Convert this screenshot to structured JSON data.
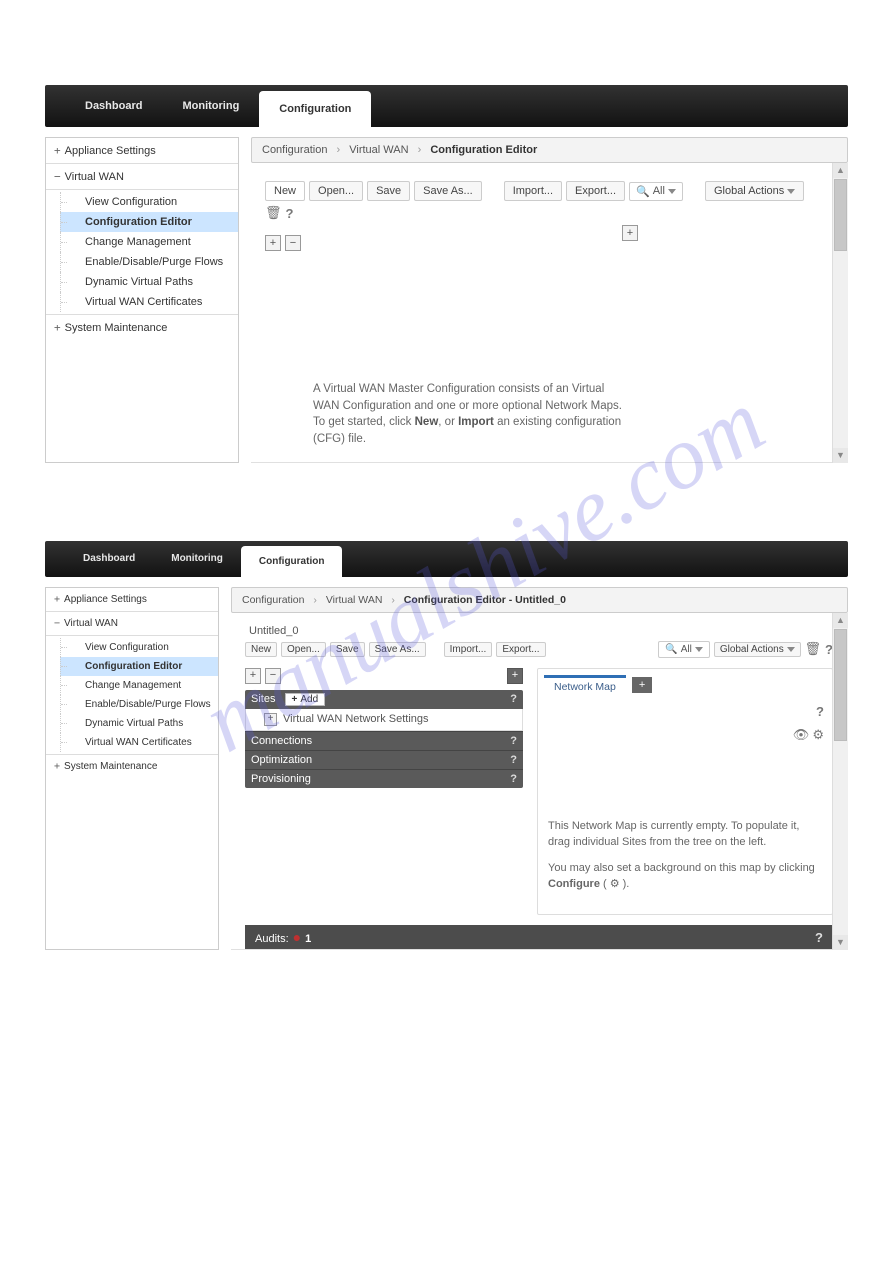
{
  "top_tabs": {
    "dashboard": "Dashboard",
    "monitoring": "Monitoring",
    "configuration": "Configuration"
  },
  "sidebar": {
    "appliance": "Appliance Settings",
    "virtual_wan": "Virtual WAN",
    "items": {
      "view": "View Configuration",
      "editor": "Configuration Editor",
      "change": "Change Management",
      "flows": "Enable/Disable/Purge Flows",
      "dynpaths": "Dynamic Virtual Paths",
      "certs": "Virtual WAN Certificates"
    },
    "sysmaint": "System Maintenance"
  },
  "bc1": {
    "a": "Configuration",
    "b": "Virtual WAN",
    "c": "Configuration Editor"
  },
  "bc2": {
    "a": "Configuration",
    "b": "Virtual WAN",
    "c": "Configuration Editor - Untitled_0"
  },
  "toolbar": {
    "new": "New",
    "open": "Open...",
    "save": "Save",
    "saveas": "Save As...",
    "import": "Import...",
    "export": "Export...",
    "all": "All",
    "global": "Global Actions"
  },
  "info1": {
    "line1": "A Virtual WAN Master Configuration consists of an Virtual WAN Configuration and one or more optional Network Maps. To get started, click ",
    "new": "New",
    "mid": ", or ",
    "import": "Import",
    "end": " an existing configuration (CFG) file."
  },
  "file_title": "Untitled_0",
  "tree": {
    "sites": "Sites",
    "add": "Add",
    "vwan_settings": "Virtual WAN Network Settings",
    "connections": "Connections",
    "optimization": "Optimization",
    "provisioning": "Provisioning"
  },
  "networkmap": {
    "tab": "Network Map",
    "p1": "This Network Map is currently empty. To populate it, drag individual Sites from the tree on the left.",
    "p2a": "You may also set a background on this map by clicking ",
    "p2b": "Configure",
    "p2c": " ( ⚙ )."
  },
  "audits": {
    "label": "Audits:",
    "count": "1"
  },
  "watermark": "manualshive.com"
}
